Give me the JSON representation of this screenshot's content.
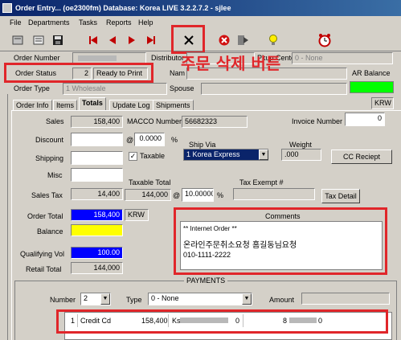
{
  "window": {
    "title": "Order Entry... (oe2300fm)  Database: Korea LIVE 3.2.2.7.2 - sjlee"
  },
  "menu": [
    "File",
    "Departments",
    "Tasks",
    "Reports",
    "Help"
  ],
  "header": {
    "order_number_label": "Order Number",
    "distributor_label": "Distributor",
    "pkup_center_label": "Pkup Center",
    "pkup_center_value": "0 - None",
    "order_status_label": "Order Status",
    "order_status_code": "2",
    "order_status_text": "Ready to Print",
    "name_label": "Nam",
    "order_type_label": "Order Type",
    "order_type_value": "1 Wholesale",
    "spouse_label": "Spouse",
    "ar_balance_label": "AR Balance",
    "currency": "KRW"
  },
  "annotation": {
    "delete_button_text": "주문 삭제 버튼"
  },
  "tabs": [
    "Order Info",
    "Items",
    "Totals",
    "Update Log",
    "Shipments"
  ],
  "totals": {
    "sales_label": "Sales",
    "sales_value": "158,400",
    "macco_label": "MACCO Number",
    "macco_value": "56682323",
    "invoice_label": "Invoice Number",
    "invoice_value": "0",
    "discount_label": "Discount",
    "discount_pct_prefix": "@",
    "discount_pct": "0.0000",
    "pct": "%",
    "shipping_label": "Shipping",
    "taxable_label": "Taxable",
    "ship_via_label": "Ship Via",
    "ship_via_value": "1 Korea Express",
    "weight_label": "Weight",
    "weight_value": ".000",
    "cc_receipt": "CC Reciept",
    "misc_label": "Misc",
    "taxable_total_label": "Taxable Total",
    "taxable_total_value": "144,000",
    "tax_rate_prefix": "@",
    "tax_rate": "10.00000",
    "tax_exempt_label": "Tax Exempt #",
    "sales_tax_label": "Sales Tax",
    "sales_tax_value": "14,400",
    "tax_detail": "Tax Detail",
    "order_total_label": "Order Total",
    "order_total_value": "158,400",
    "order_total_currency": "KRW",
    "balance_label": "Balance",
    "qualifying_vol_label": "Qualifying Vol",
    "qualifying_vol_value": "100.00",
    "retail_total_label": "Retail Total",
    "retail_total_value": "144,000"
  },
  "comments": {
    "label": "Comments",
    "line1": "** Internet Order **",
    "line2": "온라인주문취소요청 홈길동님요청",
    "line3": "010-1111-2222"
  },
  "payments": {
    "section_label": "PAYMENTS",
    "number_label": "Number",
    "number_value": "2",
    "type_label": "Type",
    "type_value": "0 - None",
    "amount_label": "Amount",
    "row": {
      "index": "1",
      "method": "Credit Cd",
      "amount": "158,400",
      "c1": "Ks",
      "c2": "0",
      "c3": "8",
      "c4": "0"
    }
  },
  "colors": {
    "order_total_bg": "#0000ff",
    "balance_bg": "#ffff00",
    "qualifying_bg": "#0000ff",
    "ar_balance_bg": "#00ff00",
    "annotation_red": "#e0262a"
  }
}
